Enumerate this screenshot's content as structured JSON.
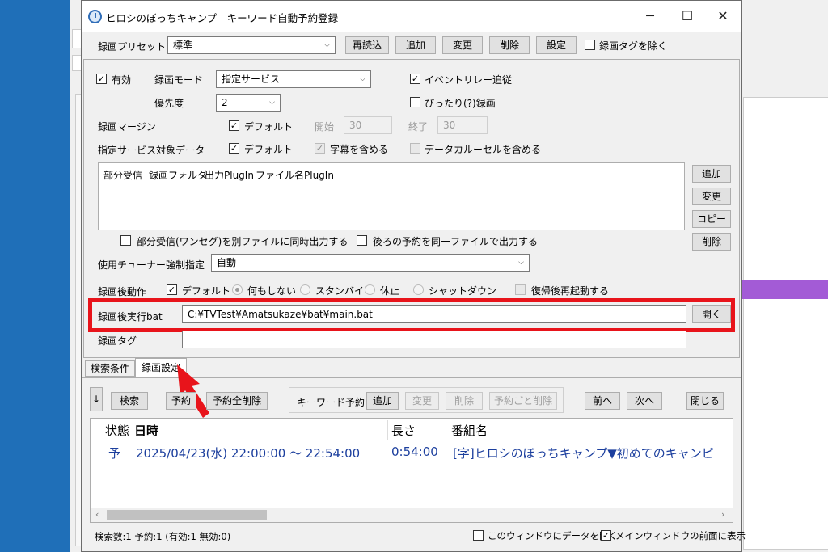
{
  "title": "ヒロシのぼっちキャンプ - キーワード自動予約登録",
  "caption": {
    "minimize": "─",
    "maximize": "☐",
    "close": "✕"
  },
  "preset": {
    "label": "録画プリセット",
    "value": "標準",
    "reload": "再読込",
    "add": "追加",
    "change": "変更",
    "delete": "削除",
    "settings": "設定",
    "exclude_tag": "録画タグを除く"
  },
  "settings": {
    "enabled": "有効",
    "rec_mode_label": "録画モード",
    "rec_mode_value": "指定サービス",
    "event_relay": "イベントリレー追従",
    "priority_label": "優先度",
    "priority_value": "2",
    "pittari": "ぴったり(?)録画",
    "margin_label": "録画マージン",
    "margin_default": "デフォルト",
    "start_label": "開始",
    "start_value": "30",
    "end_label": "終了",
    "end_value": "30",
    "service_data_label": "指定サービス対象データ",
    "service_default": "デフォルト",
    "include_caption": "字幕を含める",
    "include_carousel": "データカルーセルを含める",
    "columns": [
      "部分受信",
      "録画フォルダ",
      "出力PlugIn",
      "ファイル名PlugIn"
    ],
    "folder_add": "追加",
    "folder_change": "変更",
    "folder_copy": "コピー",
    "folder_delete": "削除",
    "partial_separate": "部分受信(ワンセグ)を別ファイルに同時出力する",
    "continue_same_file": "後ろの予約を同一ファイルで出力する",
    "tuner_label": "使用チューナー強制指定",
    "tuner_value": "自動",
    "after_label": "録画後動作",
    "after_default": "デフォルト",
    "after_options": [
      "何もしない",
      "スタンバイ",
      "休止",
      "シャットダウン"
    ],
    "reboot": "復帰後再起動する",
    "bat_label": "録画後実行bat",
    "bat_value": "C:¥TVTest¥Amatsukaze¥bat¥main.bat",
    "open": "開く",
    "tag_label": "録画タグ"
  },
  "tabs": [
    "検索条件",
    "録画設定"
  ],
  "toolbar": {
    "down": "↓",
    "search": "検索",
    "reserve": "予約",
    "delete_all": "予約全削除",
    "keyword_reserve": "キーワード予約",
    "add": "追加",
    "change": "変更",
    "delete": "削除",
    "delete_with_reserve": "予約ごと削除",
    "prev": "前へ",
    "next": "次へ",
    "close": "閉じる"
  },
  "results": {
    "columns": [
      "状態",
      "日時",
      "長さ",
      "番組名"
    ],
    "rows": [
      {
        "state": "予",
        "datetime": "2025/04/23(水) 22:00:00 ～ 22:54:00",
        "length": "0:54:00",
        "title": "[字]ヒロシのぼっちキャンプ▼初めてのキャンピ"
      }
    ]
  },
  "status": {
    "summary": "検索数:1 予約:1 (有効:1 無効:0)",
    "open_data": "このウィンドウにデータを開く",
    "keep_front": "メインウィンドウの前面に表示"
  },
  "colors": {
    "highlight": "#e8141b",
    "arrow": "#e8141b",
    "link_text": "#1c3f9e"
  }
}
